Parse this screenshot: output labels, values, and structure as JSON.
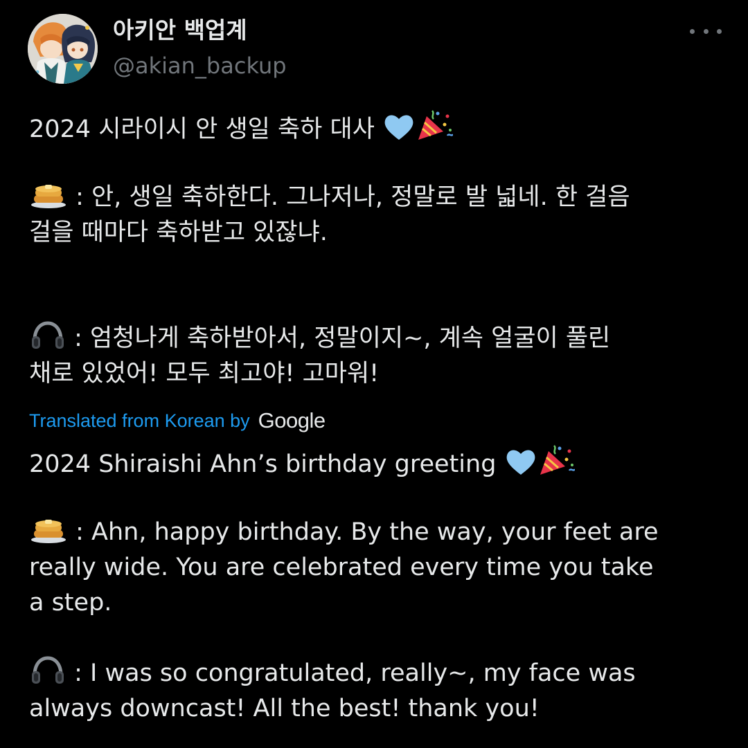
{
  "author": {
    "display_name": "아키안 백업계",
    "handle": "@akian_backup",
    "avatar_icon": "avatar-anime-illustration"
  },
  "more_icon": "more-horizontal-icon",
  "original": {
    "title": "2024 시라이시 안 생일 축하 대사",
    "line1_a": " : 안, 생일 축하한다. 그나저나, 정말로 발 넓네. 한 걸음",
    "line1_b": "걸을 때마다 축하받고 있잖냐.",
    "line2_a": " : 엄청나게 축하받아서, 정말이지~, 계속 얼굴이 풀린",
    "line2_b": "채로 있었어! 모두 최고야! 고마워!"
  },
  "translation": {
    "label": "Translated from Korean by",
    "provider": "Google",
    "title": "2024 Shiraishi Ahn’s birthday greeting",
    "line1_a": " : Ahn, happy birthday. By the way, your feet are",
    "line1_b": "really wide. You are celebrated every time you take",
    "line1_c": "a step.",
    "line2_a": " : I was so congratulated, really~, my face was",
    "line2_b": "always downcast! All the best! thank you!"
  },
  "emoji": {
    "heart": "light-blue-heart-icon",
    "party": "party-popper-icon",
    "pancakes": "pancakes-icon",
    "headphones": "headphones-icon"
  },
  "colors": {
    "background": "#000000",
    "text": "#e7e9ea",
    "muted": "#71767b",
    "link": "#1d9bf0",
    "heart": "#8fc9f2"
  }
}
